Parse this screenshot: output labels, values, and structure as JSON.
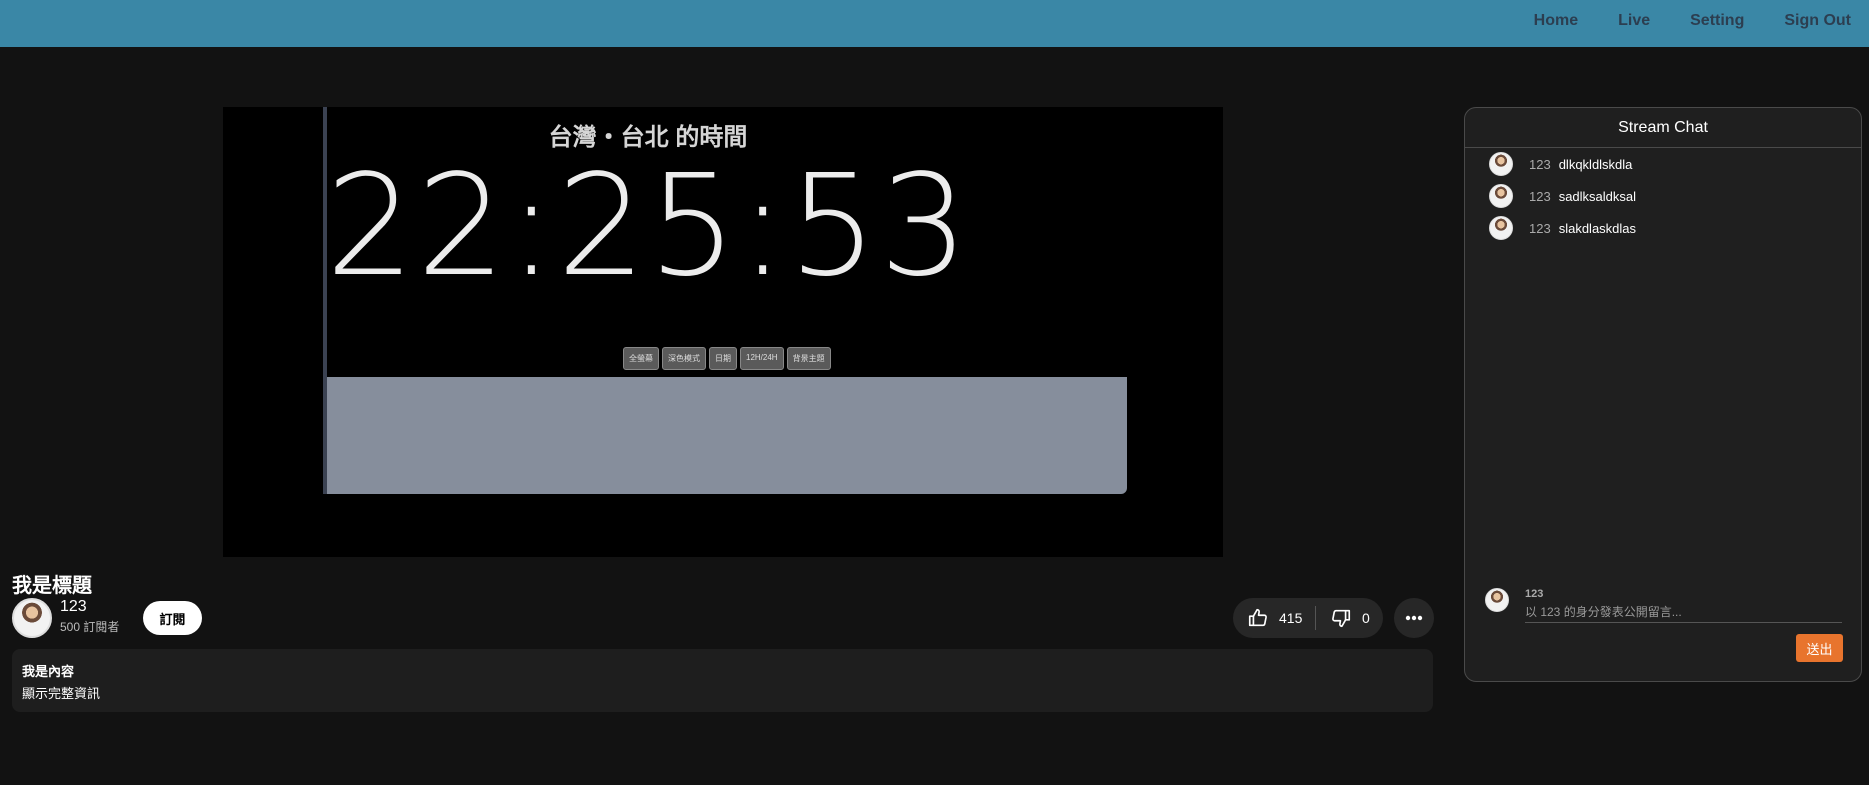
{
  "nav": {
    "home": "Home",
    "live": "Live",
    "setting": "Setting",
    "sign_out": "Sign Out"
  },
  "video": {
    "clock_title": "台灣・台北 的時間",
    "clock_time": "22:25:53",
    "clock_buttons": [
      "全螢幕",
      "深色模式",
      "日期",
      "12H/24H",
      "背景主題"
    ]
  },
  "stream": {
    "title": "我是標題",
    "channel_name": "123",
    "subscribers": "500 訂閱者",
    "subscribe_label": "訂閱",
    "likes": "415",
    "dislikes": "0",
    "description_title": "我是內容",
    "description_more": "顯示完整資訊"
  },
  "chat": {
    "header": "Stream Chat",
    "messages": [
      {
        "user": "123",
        "text": "dlkqkldlskdla"
      },
      {
        "user": "123",
        "text": "sadlksaldksal"
      },
      {
        "user": "123",
        "text": "slakdlaskdlas"
      }
    ],
    "compose_user": "123",
    "compose_placeholder": "以 123 的身分發表公開留言...",
    "send_label": "送出"
  }
}
